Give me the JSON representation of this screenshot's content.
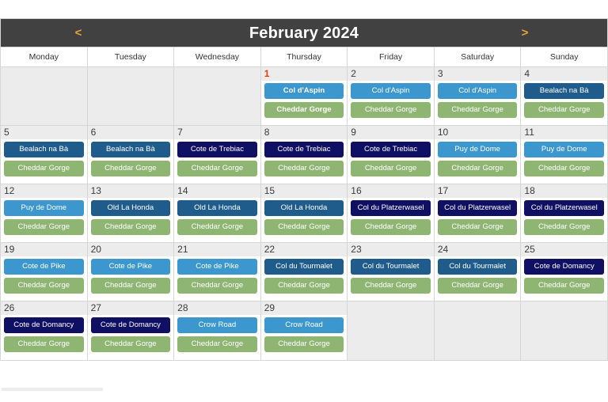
{
  "header": {
    "title": "February 2024",
    "prev_label": "<",
    "next_label": ">",
    "bar_color": "#414141",
    "accent_color": "#e8a33d"
  },
  "weekdays": [
    "Monday",
    "Tuesday",
    "Wednesday",
    "Thursday",
    "Friday",
    "Saturday",
    "Sunday"
  ],
  "event_colors": {
    "light_blue": "#3b97cd",
    "steel_blue": "#1f5c8b",
    "navy": "#0f0f63",
    "green": "#8fb573",
    "today_number": "#e23b17"
  },
  "weeks": [
    [
      {
        "day": "",
        "empty": true,
        "today": false,
        "events": []
      },
      {
        "day": "",
        "empty": true,
        "today": false,
        "events": []
      },
      {
        "day": "",
        "empty": true,
        "today": false,
        "events": []
      },
      {
        "day": "1",
        "empty": false,
        "today": true,
        "events": [
          {
            "label": "Col d'Aspin",
            "color": "#3b97cd"
          },
          {
            "label": "Cheddar Gorge",
            "color": "#8fb573"
          }
        ]
      },
      {
        "day": "2",
        "empty": false,
        "today": false,
        "events": [
          {
            "label": "Col d'Aspin",
            "color": "#3b97cd"
          },
          {
            "label": "Cheddar Gorge",
            "color": "#8fb573"
          }
        ]
      },
      {
        "day": "3",
        "empty": false,
        "today": false,
        "events": [
          {
            "label": "Col d'Aspin",
            "color": "#3b97cd"
          },
          {
            "label": "Cheddar Gorge",
            "color": "#8fb573"
          }
        ]
      },
      {
        "day": "4",
        "empty": false,
        "today": false,
        "events": [
          {
            "label": "Bealach na Bà",
            "color": "#1f5c8b"
          },
          {
            "label": "Cheddar Gorge",
            "color": "#8fb573"
          }
        ]
      }
    ],
    [
      {
        "day": "5",
        "empty": false,
        "today": false,
        "events": [
          {
            "label": "Bealach na Bà",
            "color": "#1f5c8b"
          },
          {
            "label": "Cheddar Gorge",
            "color": "#8fb573"
          }
        ]
      },
      {
        "day": "6",
        "empty": false,
        "today": false,
        "events": [
          {
            "label": "Bealach na Bà",
            "color": "#1f5c8b"
          },
          {
            "label": "Cheddar Gorge",
            "color": "#8fb573"
          }
        ]
      },
      {
        "day": "7",
        "empty": false,
        "today": false,
        "events": [
          {
            "label": "Cote de Trebiac",
            "color": "#0f0f63"
          },
          {
            "label": "Cheddar Gorge",
            "color": "#8fb573"
          }
        ]
      },
      {
        "day": "8",
        "empty": false,
        "today": false,
        "events": [
          {
            "label": "Cote de Trebiac",
            "color": "#0f0f63"
          },
          {
            "label": "Cheddar Gorge",
            "color": "#8fb573"
          }
        ]
      },
      {
        "day": "9",
        "empty": false,
        "today": false,
        "events": [
          {
            "label": "Cote de Trebiac",
            "color": "#0f0f63"
          },
          {
            "label": "Cheddar Gorge",
            "color": "#8fb573"
          }
        ]
      },
      {
        "day": "10",
        "empty": false,
        "today": false,
        "events": [
          {
            "label": "Puy de Dome",
            "color": "#3b97cd"
          },
          {
            "label": "Cheddar Gorge",
            "color": "#8fb573"
          }
        ]
      },
      {
        "day": "11",
        "empty": false,
        "today": false,
        "events": [
          {
            "label": "Puy de Dome",
            "color": "#3b97cd"
          },
          {
            "label": "Cheddar Gorge",
            "color": "#8fb573"
          }
        ]
      }
    ],
    [
      {
        "day": "12",
        "empty": false,
        "today": false,
        "events": [
          {
            "label": "Puy de Dome",
            "color": "#3b97cd"
          },
          {
            "label": "Cheddar Gorge",
            "color": "#8fb573"
          }
        ]
      },
      {
        "day": "13",
        "empty": false,
        "today": false,
        "events": [
          {
            "label": "Old La Honda",
            "color": "#1f5c8b"
          },
          {
            "label": "Cheddar Gorge",
            "color": "#8fb573"
          }
        ]
      },
      {
        "day": "14",
        "empty": false,
        "today": false,
        "events": [
          {
            "label": "Old La Honda",
            "color": "#1f5c8b"
          },
          {
            "label": "Cheddar Gorge",
            "color": "#8fb573"
          }
        ]
      },
      {
        "day": "15",
        "empty": false,
        "today": false,
        "events": [
          {
            "label": "Old La Honda",
            "color": "#1f5c8b"
          },
          {
            "label": "Cheddar Gorge",
            "color": "#8fb573"
          }
        ]
      },
      {
        "day": "16",
        "empty": false,
        "today": false,
        "events": [
          {
            "label": "Col du Platzerwasel",
            "color": "#0f0f63"
          },
          {
            "label": "Cheddar Gorge",
            "color": "#8fb573"
          }
        ]
      },
      {
        "day": "17",
        "empty": false,
        "today": false,
        "events": [
          {
            "label": "Col du Platzerwasel",
            "color": "#0f0f63"
          },
          {
            "label": "Cheddar Gorge",
            "color": "#8fb573"
          }
        ]
      },
      {
        "day": "18",
        "empty": false,
        "today": false,
        "events": [
          {
            "label": "Col du Platzerwasel",
            "color": "#0f0f63"
          },
          {
            "label": "Cheddar Gorge",
            "color": "#8fb573"
          }
        ]
      }
    ],
    [
      {
        "day": "19",
        "empty": false,
        "today": false,
        "events": [
          {
            "label": "Cote de Pike",
            "color": "#3b97cd"
          },
          {
            "label": "Cheddar Gorge",
            "color": "#8fb573"
          }
        ]
      },
      {
        "day": "20",
        "empty": false,
        "today": false,
        "events": [
          {
            "label": "Cote de Pike",
            "color": "#3b97cd"
          },
          {
            "label": "Cheddar Gorge",
            "color": "#8fb573"
          }
        ]
      },
      {
        "day": "21",
        "empty": false,
        "today": false,
        "events": [
          {
            "label": "Cote de Pike",
            "color": "#3b97cd"
          },
          {
            "label": "Cheddar Gorge",
            "color": "#8fb573"
          }
        ]
      },
      {
        "day": "22",
        "empty": false,
        "today": false,
        "events": [
          {
            "label": "Col du Tourmalet",
            "color": "#1f5c8b"
          },
          {
            "label": "Cheddar Gorge",
            "color": "#8fb573"
          }
        ]
      },
      {
        "day": "23",
        "empty": false,
        "today": false,
        "events": [
          {
            "label": "Col du Tourmalet",
            "color": "#1f5c8b"
          },
          {
            "label": "Cheddar Gorge",
            "color": "#8fb573"
          }
        ]
      },
      {
        "day": "24",
        "empty": false,
        "today": false,
        "events": [
          {
            "label": "Col du Tourmalet",
            "color": "#1f5c8b"
          },
          {
            "label": "Cheddar Gorge",
            "color": "#8fb573"
          }
        ]
      },
      {
        "day": "25",
        "empty": false,
        "today": false,
        "events": [
          {
            "label": "Cote de Domancy",
            "color": "#0f0f63"
          },
          {
            "label": "Cheddar Gorge",
            "color": "#8fb573"
          }
        ]
      }
    ],
    [
      {
        "day": "26",
        "empty": false,
        "today": false,
        "events": [
          {
            "label": "Cote de Domancy",
            "color": "#0f0f63"
          },
          {
            "label": "Cheddar Gorge",
            "color": "#8fb573"
          }
        ]
      },
      {
        "day": "27",
        "empty": false,
        "today": false,
        "events": [
          {
            "label": "Cote de Domancy",
            "color": "#0f0f63"
          },
          {
            "label": "Cheddar Gorge",
            "color": "#8fb573"
          }
        ]
      },
      {
        "day": "28",
        "empty": false,
        "today": false,
        "events": [
          {
            "label": "Crow Road",
            "color": "#3b97cd"
          },
          {
            "label": "Cheddar Gorge",
            "color": "#8fb573"
          }
        ]
      },
      {
        "day": "29",
        "empty": false,
        "today": false,
        "events": [
          {
            "label": "Crow Road",
            "color": "#3b97cd"
          },
          {
            "label": "Cheddar Gorge",
            "color": "#8fb573"
          }
        ]
      },
      {
        "day": "",
        "empty": true,
        "today": false,
        "events": []
      },
      {
        "day": "",
        "empty": true,
        "today": false,
        "events": []
      },
      {
        "day": "",
        "empty": true,
        "today": false,
        "events": []
      }
    ]
  ]
}
